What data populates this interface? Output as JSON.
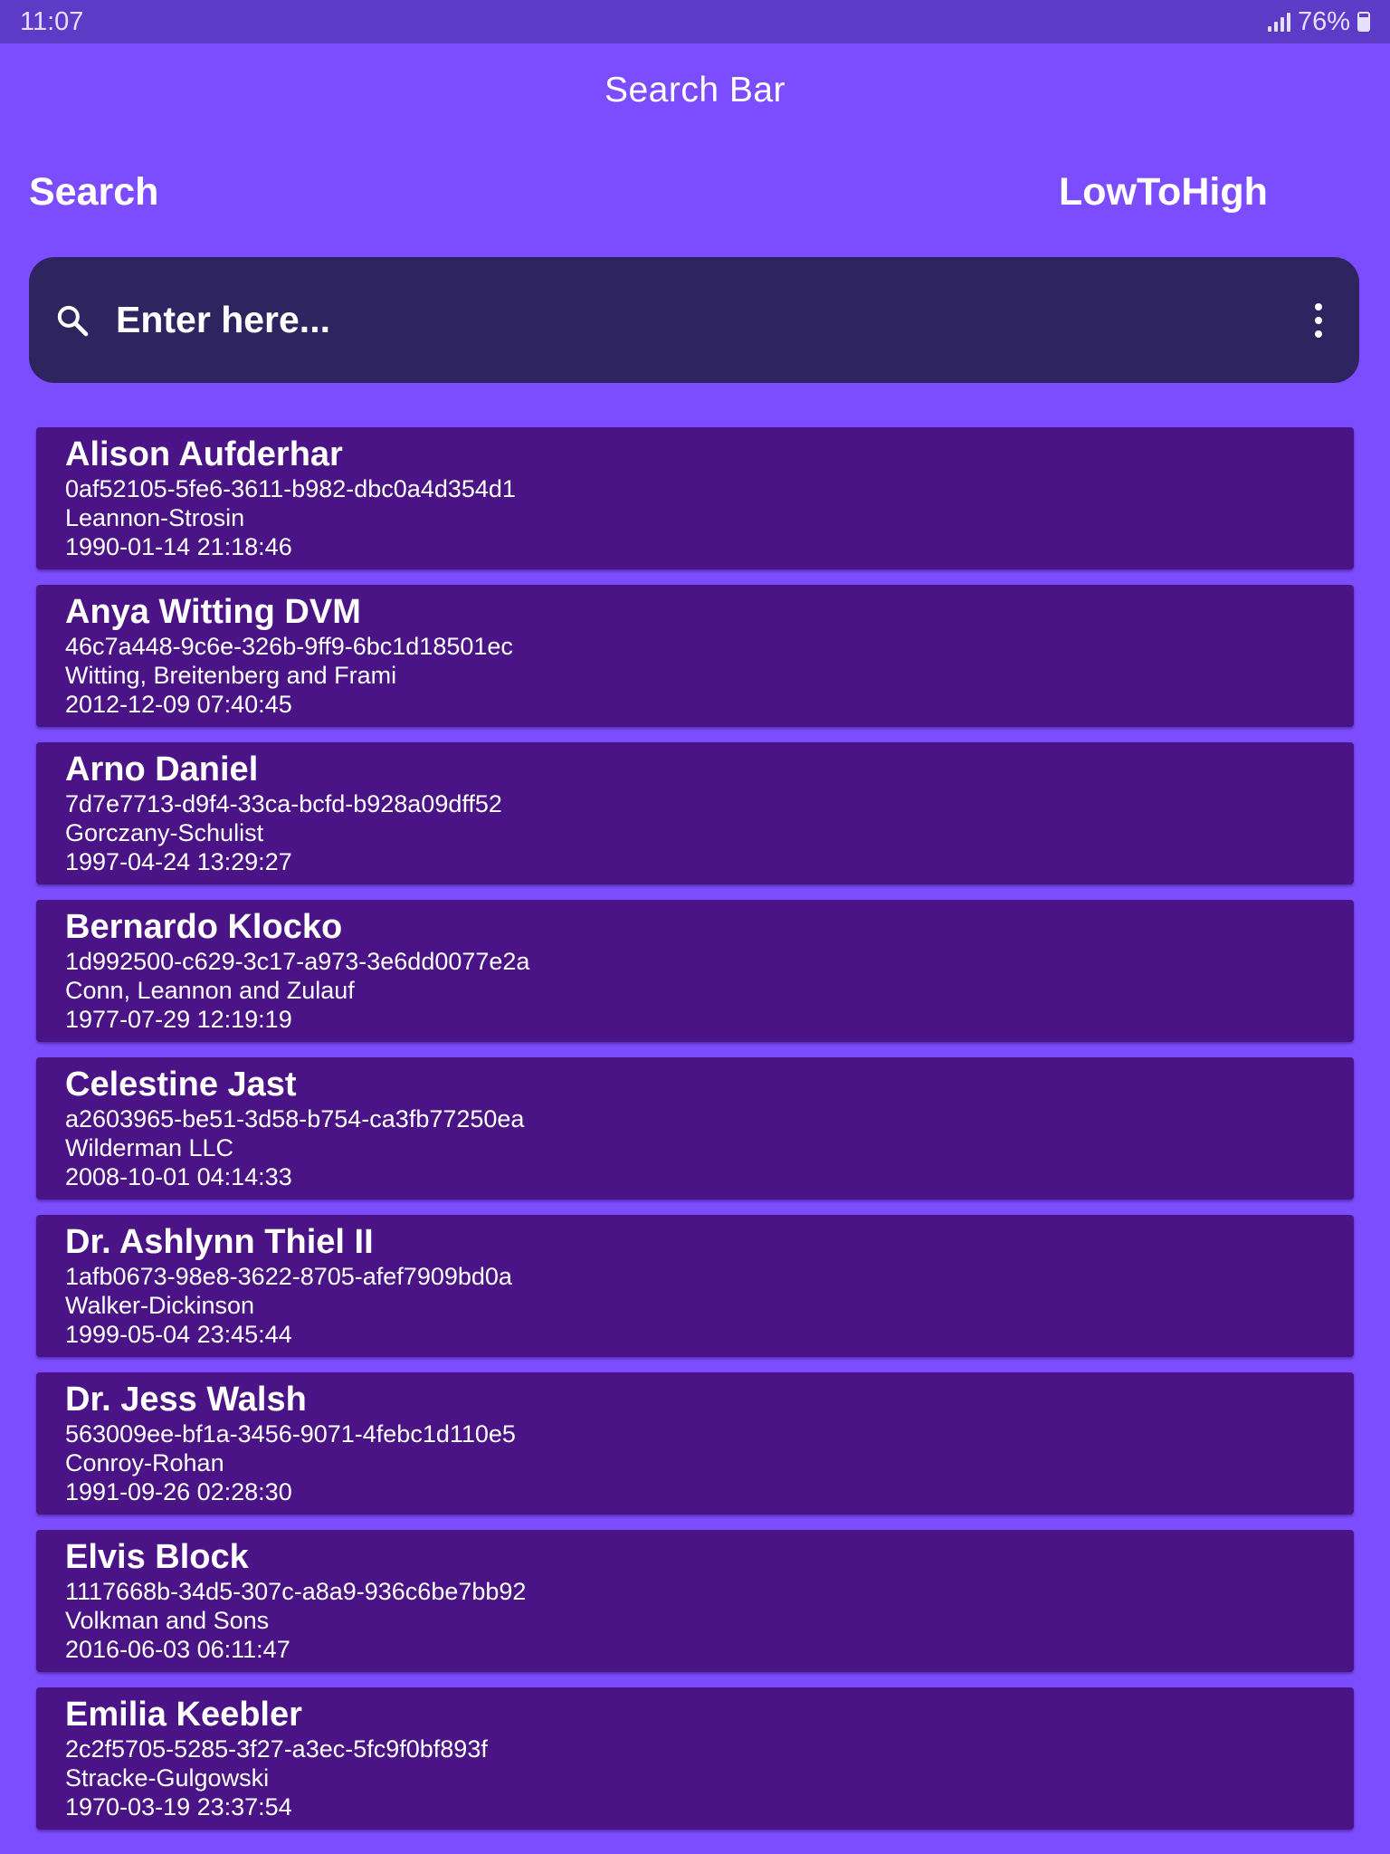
{
  "status_bar": {
    "time": "11:07",
    "battery": "76%"
  },
  "app_bar": {
    "title": "Search Bar"
  },
  "header": {
    "search_label": "Search",
    "sort_label": "LowToHigh"
  },
  "search": {
    "placeholder": "Enter here...",
    "value": ""
  },
  "icons": {
    "search": "search-icon",
    "menu": "more-vertical-icon"
  },
  "colors": {
    "background": "#7c4dff",
    "status_bar": "#5e3bc6",
    "search_bar": "#2e2460",
    "card": "#4a1486"
  },
  "contacts": [
    {
      "name": "Alison Aufderhar",
      "id": "0af52105-5fe6-3611-b982-dbc0a4d354d1",
      "company": "Leannon-Strosin",
      "date": "1990-01-14 21:18:46"
    },
    {
      "name": "Anya Witting DVM",
      "id": "46c7a448-9c6e-326b-9ff9-6bc1d18501ec",
      "company": "Witting, Breitenberg and Frami",
      "date": "2012-12-09 07:40:45"
    },
    {
      "name": "Arno Daniel",
      "id": "7d7e7713-d9f4-33ca-bcfd-b928a09dff52",
      "company": "Gorczany-Schulist",
      "date": "1997-04-24 13:29:27"
    },
    {
      "name": "Bernardo Klocko",
      "id": "1d992500-c629-3c17-a973-3e6dd0077e2a",
      "company": "Conn, Leannon and Zulauf",
      "date": "1977-07-29 12:19:19"
    },
    {
      "name": "Celestine Jast",
      "id": "a2603965-be51-3d58-b754-ca3fb77250ea",
      "company": "Wilderman LLC",
      "date": "2008-10-01 04:14:33"
    },
    {
      "name": "Dr. Ashlynn Thiel II",
      "id": "1afb0673-98e8-3622-8705-afef7909bd0a",
      "company": "Walker-Dickinson",
      "date": "1999-05-04 23:45:44"
    },
    {
      "name": "Dr. Jess Walsh",
      "id": "563009ee-bf1a-3456-9071-4febc1d110e5",
      "company": "Conroy-Rohan",
      "date": "1991-09-26 02:28:30"
    },
    {
      "name": "Elvis Block",
      "id": "1117668b-34d5-307c-a8a9-936c6be7bb92",
      "company": "Volkman and Sons",
      "date": "2016-06-03 06:11:47"
    },
    {
      "name": "Emilia Keebler",
      "id": "2c2f5705-5285-3f27-a3ec-5fc9f0bf893f",
      "company": "Stracke-Gulgowski",
      "date": "1970-03-19 23:37:54"
    }
  ]
}
